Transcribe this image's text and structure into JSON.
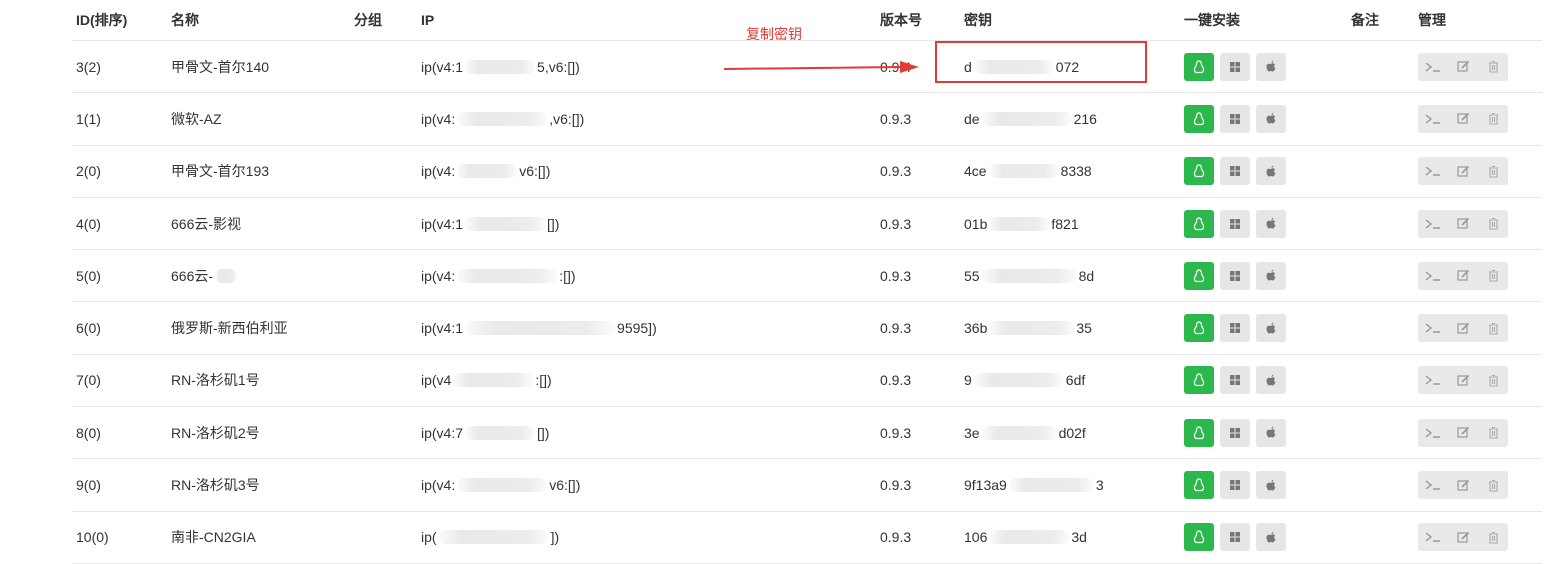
{
  "columns": {
    "id": "ID(排序)",
    "name": "名称",
    "group": "分组",
    "ip": "IP",
    "version": "版本号",
    "key": "密钥",
    "install": "一键安装",
    "note": "备注",
    "manage": "管理"
  },
  "annotation": {
    "label": "复制密钥",
    "color": "#e53935"
  },
  "rows": [
    {
      "id": "3(2)",
      "name": "甲骨文-首尔140",
      "ip_start": "ip(v4:1",
      "ip_end": "5,v6:[])",
      "version": "0.9.4",
      "key_start": "d",
      "key_end": "072"
    },
    {
      "id": "1(1)",
      "name": "微软-AZ",
      "ip_start": "ip(v4:",
      "ip_end": ",v6:[])",
      "version": "0.9.3",
      "key_start": "de",
      "key_end": "216"
    },
    {
      "id": "2(0)",
      "name": "甲骨文-首尔193",
      "ip_start": "ip(v4:",
      "ip_end": "v6:[])",
      "version": "0.9.3",
      "key_start": "4ce",
      "key_end": "8338"
    },
    {
      "id": "4(0)",
      "name": "666云-影视",
      "ip_start": "ip(v4:1",
      "ip_end": "[])",
      "version": "0.9.3",
      "key_start": "01b",
      "key_end": "f821"
    },
    {
      "id": "5(0)",
      "name": "666云-",
      "ip_start": "ip(v4:",
      "ip_end": ":[])",
      "version": "0.9.3",
      "key_start": "55",
      "key_end": "8d"
    },
    {
      "id": "6(0)",
      "name": "俄罗斯-新西伯利亚",
      "ip_start": "ip(v4:1",
      "ip_end": "9595])",
      "version": "0.9.3",
      "key_start": "36b",
      "key_end": "35"
    },
    {
      "id": "7(0)",
      "name": "RN-洛杉矶1号",
      "ip_start": "ip(v4",
      "ip_end": ":[])",
      "version": "0.9.3",
      "key_start": "9",
      "key_end": "6df"
    },
    {
      "id": "8(0)",
      "name": "RN-洛杉矶2号",
      "ip_start": "ip(v4:7",
      "ip_end": "[])",
      "version": "0.9.3",
      "key_start": "3e",
      "key_end": "d02f"
    },
    {
      "id": "9(0)",
      "name": "RN-洛杉矶3号",
      "ip_start": "ip(v4:",
      "ip_end": "v6:[])",
      "version": "0.9.3",
      "key_start": "9f13a9",
      "key_end": "3"
    },
    {
      "id": "10(0)",
      "name": "南非-CN2GIA",
      "ip_start": "ip(",
      "ip_end": "])",
      "version": "0.9.3",
      "key_start": "106",
      "key_end": "3d"
    }
  ],
  "install_buttons": [
    "linux-icon",
    "windows-icon",
    "apple-icon"
  ],
  "manage_buttons": [
    "terminal-icon",
    "edit-icon",
    "delete-icon"
  ]
}
